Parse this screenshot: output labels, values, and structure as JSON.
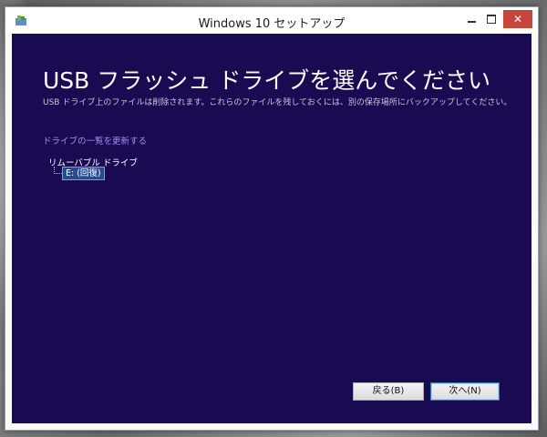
{
  "window": {
    "title": "Windows 10 セットアップ",
    "controls": {
      "minimize": "",
      "maximize": "",
      "close": "✕"
    }
  },
  "page": {
    "title": "USB フラッシュ ドライブを選んでください",
    "subtitle": "USB ドライブ上のファイルは削除されます。これらのファイルを残しておくには、別の保存場所にバックアップしてください。",
    "refresh_link": "ドライブの一覧を更新する"
  },
  "drive_tree": {
    "root_label": "リムーバブル ドライブ",
    "selected_drive": "E: (回復)"
  },
  "buttons": {
    "back": "戻る(B)",
    "next": "次へ(N)"
  },
  "colors": {
    "client_background": "#1a0a52",
    "link": "#a98bf0",
    "close_button": "#c7453a"
  }
}
